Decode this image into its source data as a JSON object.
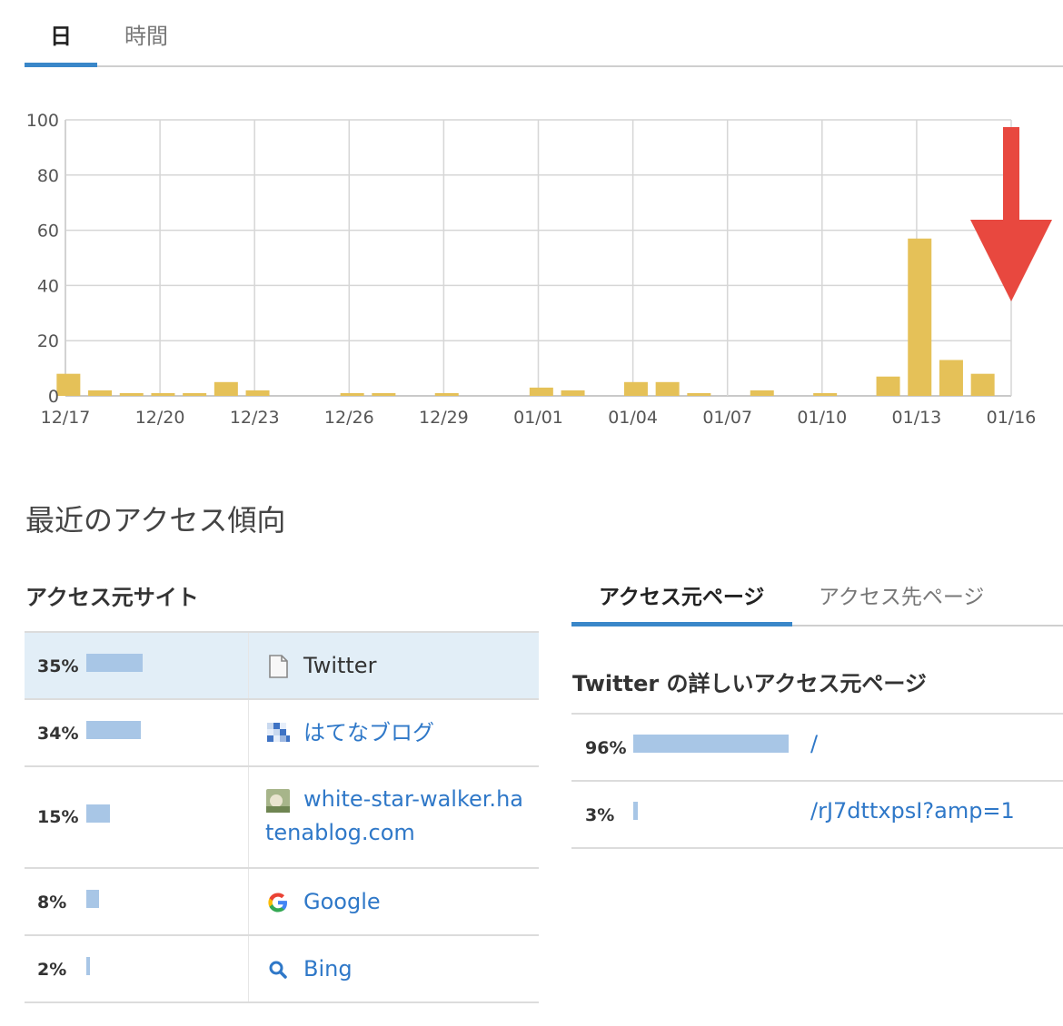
{
  "top_tabs": {
    "day": "日",
    "hour": "時間"
  },
  "chart_data": {
    "type": "bar",
    "categories": [
      "12/17",
      "12/18",
      "12/19",
      "12/20",
      "12/21",
      "12/22",
      "12/23",
      "12/24",
      "12/25",
      "12/26",
      "12/27",
      "12/28",
      "12/29",
      "12/30",
      "12/31",
      "01/01",
      "01/02",
      "01/03",
      "01/04",
      "01/05",
      "01/06",
      "01/07",
      "01/08",
      "01/09",
      "01/10",
      "01/11",
      "01/12",
      "01/13",
      "01/14",
      "01/15",
      "01/16"
    ],
    "values": [
      8,
      2,
      1,
      1,
      1,
      5,
      2,
      0,
      0,
      1,
      1,
      0,
      1,
      0,
      0,
      3,
      2,
      0,
      5,
      5,
      1,
      0,
      2,
      0,
      1,
      0,
      7,
      57,
      13,
      8,
      0
    ],
    "x_tick_labels": [
      "12/17",
      "12/20",
      "12/23",
      "12/26",
      "12/29",
      "01/01",
      "01/04",
      "01/07",
      "01/10",
      "01/13",
      "01/16"
    ],
    "y_tick_labels": [
      "0",
      "20",
      "40",
      "60",
      "80",
      "100"
    ],
    "ylim": [
      0,
      100
    ],
    "grid": true,
    "bar_color": "#e5c158",
    "annotation": {
      "type": "arrow",
      "color": "#e8483f",
      "points_at": "01/16"
    }
  },
  "section_title": "最近のアクセス傾向",
  "access_sources": {
    "title": "アクセス元サイト",
    "rows": [
      {
        "percent": "35%",
        "fraction": 0.35,
        "site": "Twitter",
        "icon": "document-icon",
        "selected": true
      },
      {
        "percent": "34%",
        "fraction": 0.34,
        "site": "はてなブログ",
        "icon": "hatena-blog-icon",
        "selected": false
      },
      {
        "percent": "15%",
        "fraction": 0.15,
        "site": "white-star-walker.hatenablog.com",
        "icon": "blog-thumbnail-icon",
        "selected": false
      },
      {
        "percent": "8%",
        "fraction": 0.08,
        "site": "Google",
        "icon": "google-icon",
        "selected": false
      },
      {
        "percent": "2%",
        "fraction": 0.02,
        "site": "Bing",
        "icon": "search-icon",
        "selected": false
      }
    ]
  },
  "page_tabs": {
    "source_page": "アクセス元ページ",
    "dest_page": "アクセス先ページ"
  },
  "detail": {
    "title": "Twitter の詳しいアクセス元ページ",
    "rows": [
      {
        "percent": "96%",
        "fraction": 0.96,
        "path": "/"
      },
      {
        "percent": "3%",
        "fraction": 0.03,
        "path": "/rJ7dttxpsI?amp=1"
      }
    ]
  }
}
